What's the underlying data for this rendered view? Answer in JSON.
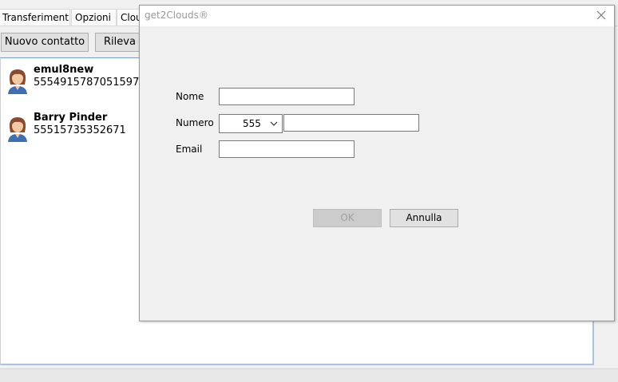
{
  "app": {
    "tabs": [
      {
        "label": "Transferimenti"
      },
      {
        "label": "Opzioni"
      },
      {
        "label": "Clou"
      }
    ],
    "buttons": {
      "new_contact": "Nuovo contatto",
      "detect": "Rileva c"
    },
    "contacts": [
      {
        "name": "emul8new",
        "number": "5554915787051597"
      },
      {
        "name": "Barry Pinder",
        "number": "55515735352671"
      }
    ]
  },
  "dialog": {
    "title": "get2Clouds®",
    "labels": {
      "name": "Nome",
      "number": "Numero",
      "email": "Email"
    },
    "fields": {
      "name_value": "",
      "number_prefix": "555",
      "number_value": "",
      "email_value": ""
    },
    "buttons": {
      "ok": "OK",
      "cancel": "Annulla"
    }
  }
}
